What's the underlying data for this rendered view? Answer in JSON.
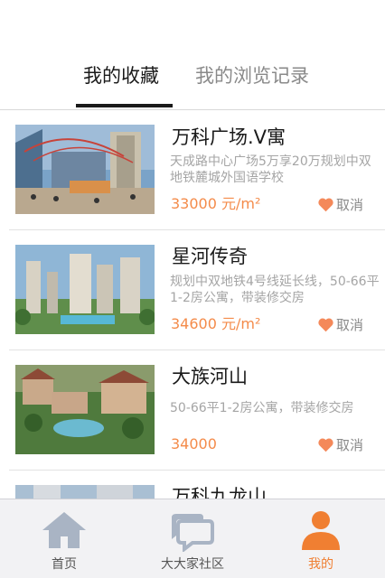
{
  "tabs": [
    {
      "label": "我的收藏",
      "active": true
    },
    {
      "label": "我的浏览记录",
      "active": false
    }
  ],
  "favorites": [
    {
      "title": "万科广场.V寓",
      "desc": "天成路中心广场5万享20万规划中双地铁麓城外国语学校",
      "price": "33000 元/m²",
      "action": "取消"
    },
    {
      "title": "星河传奇",
      "desc": "规划中双地铁4号线延长线，50-66平1-2房公寓，带装修交房",
      "price": "34600 元/m²",
      "action": "取消"
    },
    {
      "title": "大族河山",
      "desc": "50-66平1-2房公寓，带装修交房",
      "price": "34000",
      "action": "取消"
    },
    {
      "title": "万科九龙山",
      "desc": "",
      "price": "",
      "action": ""
    }
  ],
  "nav": [
    {
      "label": "首页",
      "icon": "home-icon",
      "active": false
    },
    {
      "label": "大大家社区",
      "icon": "chat-bubbles-icon",
      "active": false
    },
    {
      "label": "我的",
      "icon": "user-icon",
      "active": true
    }
  ],
  "colors": {
    "accent": "#f07f32",
    "price": "#f48b4a",
    "heart": "#f4895a"
  }
}
